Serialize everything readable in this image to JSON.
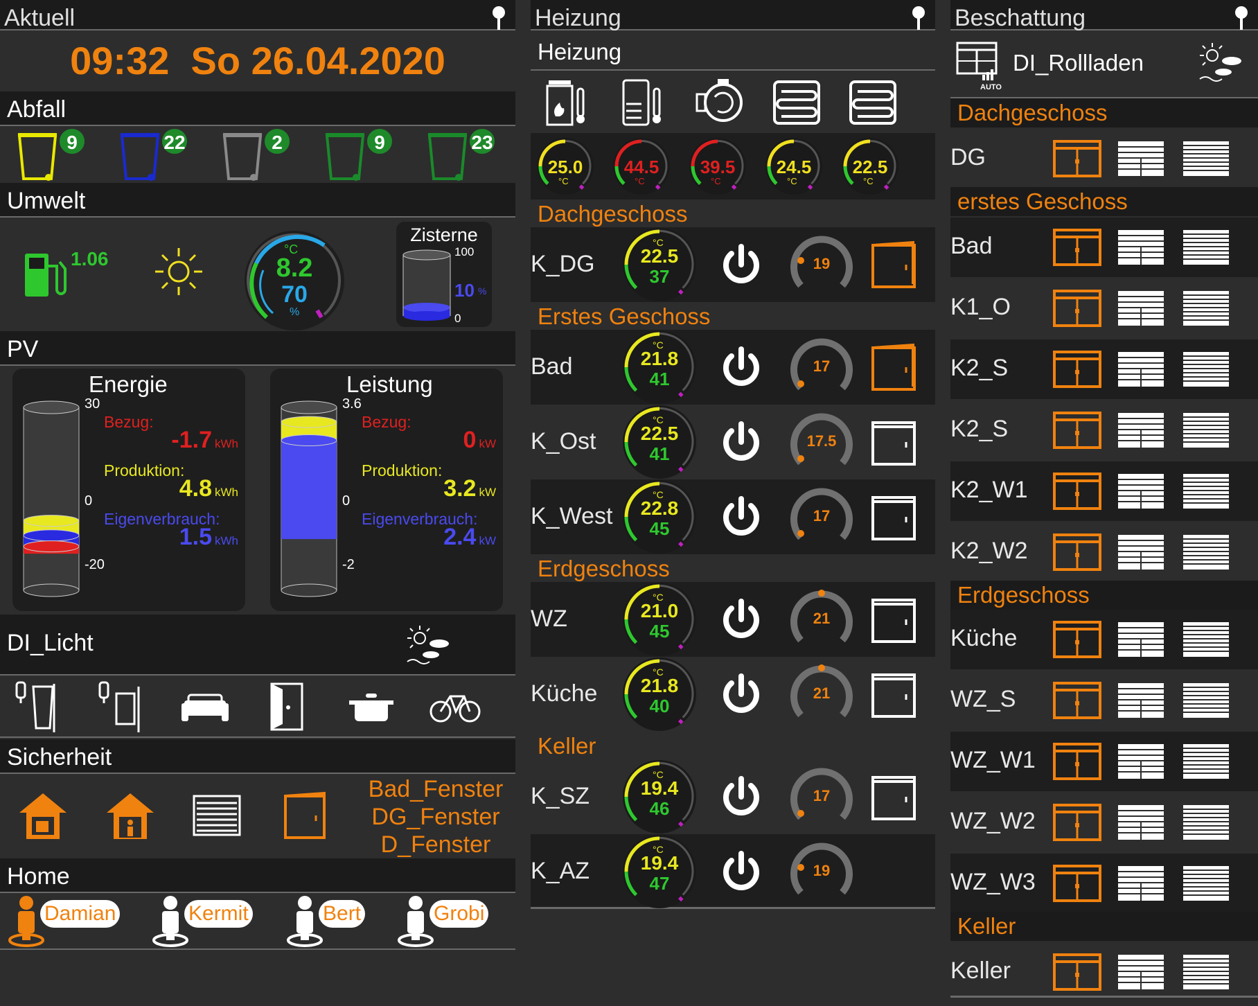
{
  "aktuell": {
    "title": "Aktuell",
    "time": "09:32",
    "date": "So 26.04.2020"
  },
  "abfall": {
    "title": "Abfall",
    "bins": [
      {
        "icon": "yellow-bin-icon",
        "count": "9",
        "color": "#e8e800"
      },
      {
        "icon": "blue-bin-icon",
        "count": "22",
        "color": "#1a2ad0"
      },
      {
        "icon": "grey-bin-icon",
        "count": "2",
        "color": "#8a8a8a"
      },
      {
        "icon": "green-bin-icon",
        "count": "9",
        "color": "#1a8a2a"
      },
      {
        "icon": "garden-waste-icon",
        "count": "23",
        "color": "#1a8a2a"
      }
    ]
  },
  "umwelt": {
    "title": "Umwelt",
    "fuel_price": "1.06",
    "temp_unit": "°C",
    "temperature": "8.2",
    "humidity": "70",
    "humidity_unit": "%",
    "zisterne": {
      "title": "Zisterne",
      "max": "100",
      "min": "0",
      "level": "10",
      "unit": "%",
      "level_fraction": 0.1
    }
  },
  "pv": {
    "title": "PV",
    "energie": {
      "title": "Energie",
      "scale_max": "30",
      "scale_zero": "0",
      "scale_min": "-20",
      "bezug_label": "Bezug:",
      "bezug": "-1.7",
      "unit": "kWh",
      "produktion_label": "Produktion:",
      "produktion": "4.8",
      "eigen_label": "Eigenverbrauch:",
      "eigen": "1.5"
    },
    "leistung": {
      "title": "Leistung",
      "scale_max": "3.6",
      "scale_zero": "0",
      "scale_min": "-2",
      "bezug_label": "Bezug:",
      "bezug": "0",
      "unit": "kW",
      "produktion_label": "Produktion:",
      "produktion": "3.2",
      "eigen_label": "Eigenverbrauch:",
      "eigen": "2.4"
    }
  },
  "licht": {
    "title": "DI_Licht",
    "icons": [
      "lamp-window-icon",
      "lamp-door-icon",
      "sofa-icon",
      "door-icon",
      "cooking-pot-icon",
      "bicycle-icon"
    ]
  },
  "sicherheit": {
    "title": "Sicherheit",
    "windows": [
      "Bad_Fenster",
      "DG_Fenster",
      "D_Fenster"
    ]
  },
  "home": {
    "title": "Home",
    "persons": [
      "Damian",
      "Kermit",
      "Bert",
      "Grobi"
    ]
  },
  "heizung": {
    "title": "Heizung",
    "subtitle": "Heizung",
    "unit": "°C",
    "temps": [
      "25.0",
      "44.5",
      "39.5",
      "24.5",
      "22.5"
    ],
    "temp_colors": [
      "#f0e020",
      "#e02020",
      "#e02020",
      "#f0e020",
      "#f0e020"
    ],
    "floors": {
      "dg": "Dachgeschoss",
      "og": "Erstes Geschoss",
      "eg": "Erdgeschoss",
      "keller": "Keller"
    },
    "rooms": [
      {
        "name": "K_DG",
        "temp": "22.5",
        "hum": "37",
        "set": "19",
        "window": "open"
      },
      {
        "name": "Bad",
        "temp": "21.8",
        "hum": "41",
        "set": "17",
        "window": "open"
      },
      {
        "name": "K_Ost",
        "temp": "22.5",
        "hum": "41",
        "set": "17.5",
        "window": "closed"
      },
      {
        "name": "K_West",
        "temp": "22.8",
        "hum": "45",
        "set": "17",
        "window": "closed"
      },
      {
        "name": "WZ",
        "temp": "21.0",
        "hum": "45",
        "set": "21",
        "window": "closed"
      },
      {
        "name": "Küche",
        "temp": "21.8",
        "hum": "40",
        "set": "21",
        "window": "closed"
      },
      {
        "name": "K_SZ",
        "temp": "19.4",
        "hum": "46",
        "set": "17",
        "window": "closed"
      },
      {
        "name": "K_AZ",
        "temp": "19.4",
        "hum": "47",
        "set": "19",
        "window": "none"
      }
    ]
  },
  "beschattung": {
    "title": "Beschattung",
    "device": "DI_Rollladen",
    "auto_label": "AUTO",
    "floors": {
      "dg": "Dachgeschoss",
      "og": "erstes Geschoss",
      "eg": "Erdgeschoss",
      "keller": "Keller"
    },
    "rooms": [
      "DG",
      "Bad",
      "K1_O",
      "K2_S",
      "K2_S",
      "K2_W1",
      "K2_W2",
      "Küche",
      "WZ_S",
      "WZ_W1",
      "WZ_W2",
      "WZ_W3",
      "Keller"
    ]
  }
}
